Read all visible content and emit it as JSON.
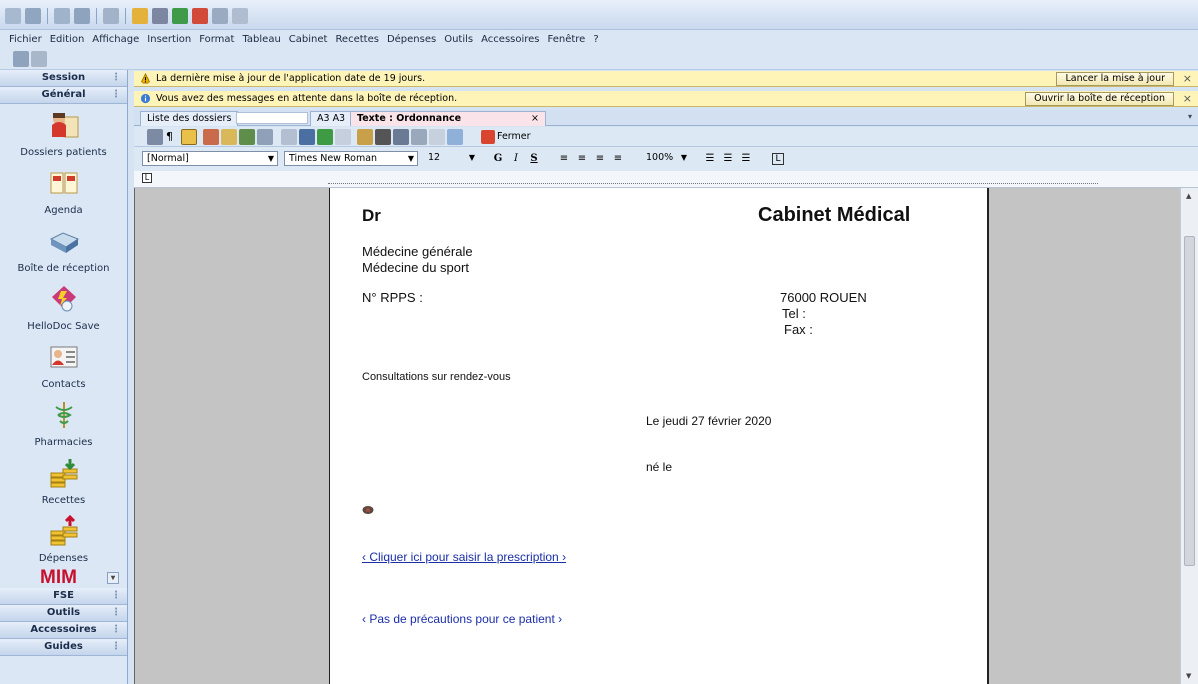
{
  "menu": [
    "Fichier",
    "Edition",
    "Affichage",
    "Insertion",
    "Format",
    "Tableau",
    "Cabinet",
    "Recettes",
    "Dépenses",
    "Outils",
    "Accessoires",
    "Fenêtre",
    "?"
  ],
  "sidebar": {
    "session": "Session",
    "general": "Général",
    "items": [
      {
        "label": "Dossiers patients",
        "icon": "patient-folder-icon"
      },
      {
        "label": "Agenda",
        "icon": "calendar-icon"
      },
      {
        "label": "Boîte de réception",
        "icon": "inbox-tray-icon"
      },
      {
        "label": "HelloDoc Save",
        "icon": "save-shield-icon"
      },
      {
        "label": "Contacts",
        "icon": "contact-card-icon"
      },
      {
        "label": "Pharmacies",
        "icon": "caduceus-icon"
      },
      {
        "label": "Recettes",
        "icon": "income-coins-icon"
      },
      {
        "label": "Dépenses",
        "icon": "expense-coins-icon"
      }
    ],
    "brand": "MIM",
    "bottom_sections": [
      "FSE",
      "Outils",
      "Accessoires",
      "Guides"
    ]
  },
  "notifications": [
    {
      "text": "La dernière mise à jour de l'application date de 19 jours.",
      "button": "Lancer la mise à jour",
      "close": "×"
    },
    {
      "text": "Vous avez des messages en attente dans la boîte de réception.",
      "button": "Ouvrir la boîte de réception",
      "close": "×"
    }
  ],
  "tabs": {
    "list": "Liste des dossiers",
    "record": "A3 A3",
    "active": "Texte : Ordonnance",
    "close": "×"
  },
  "doctools": {
    "close_label": "Fermer"
  },
  "format": {
    "style": "[Normal]",
    "font": "Times New Roman",
    "size": "12",
    "bold": "G",
    "italic": "I",
    "underline": "S",
    "zoom": "100%"
  },
  "document": {
    "doctor": "Dr",
    "cabinet": "Cabinet Médical",
    "specialty1": "Médecine générale",
    "specialty2": "Médecine du sport",
    "rpps": "N° RPPS :",
    "city": "76000 ROUEN",
    "tel": "Tel  :",
    "fax": "Fax :",
    "consult": "Consultations sur rendez-vous",
    "date": "Le jeudi 27 février 2020",
    "born": "né le",
    "prescription_link": "‹ Cliquer ici pour saisir la prescription ›",
    "precautions_link": "‹ Pas de précautions pour ce patient ›"
  },
  "colors": {
    "notif_bg": "#fff4b8",
    "active_tab": "#fbe3ea",
    "brand_red": "#c8102e",
    "link": "#1a2ea8"
  }
}
